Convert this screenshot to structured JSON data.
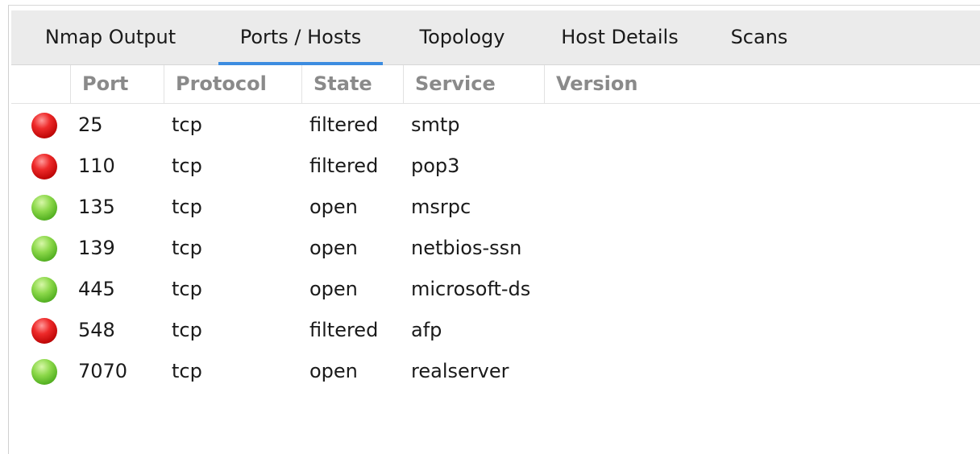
{
  "tabs": [
    {
      "label": "Nmap Output",
      "active": false
    },
    {
      "label": "Ports / Hosts",
      "active": true
    },
    {
      "label": "Topology",
      "active": false
    },
    {
      "label": "Host Details",
      "active": false
    },
    {
      "label": "Scans",
      "active": false
    }
  ],
  "columns": [
    "Port",
    "Protocol",
    "State",
    "Service",
    "Version"
  ],
  "colors": {
    "accent": "#3c8ce0",
    "open_status": "#57b324",
    "filtered_status": "#dd1a1a"
  },
  "rows": [
    {
      "port": "25",
      "protocol": "tcp",
      "state": "filtered",
      "service": "smtp",
      "version": "",
      "status_icon": "red-circle-icon"
    },
    {
      "port": "110",
      "protocol": "tcp",
      "state": "filtered",
      "service": "pop3",
      "version": "",
      "status_icon": "red-circle-icon"
    },
    {
      "port": "135",
      "protocol": "tcp",
      "state": "open",
      "service": "msrpc",
      "version": "",
      "status_icon": "green-circle-icon"
    },
    {
      "port": "139",
      "protocol": "tcp",
      "state": "open",
      "service": "netbios-ssn",
      "version": "",
      "status_icon": "green-circle-icon"
    },
    {
      "port": "445",
      "protocol": "tcp",
      "state": "open",
      "service": "microsoft-ds",
      "version": "",
      "status_icon": "green-circle-icon"
    },
    {
      "port": "548",
      "protocol": "tcp",
      "state": "filtered",
      "service": "afp",
      "version": "",
      "status_icon": "red-circle-icon"
    },
    {
      "port": "7070",
      "protocol": "tcp",
      "state": "open",
      "service": "realserver",
      "version": "",
      "status_icon": "green-circle-icon"
    }
  ]
}
